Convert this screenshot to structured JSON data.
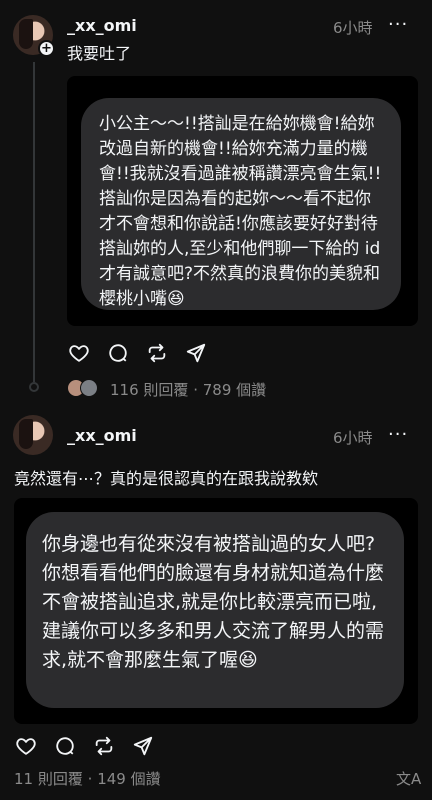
{
  "post1": {
    "username": "_xx_omi",
    "time": "6小時",
    "more_icon": "more-horizontal-icon",
    "text": "我要吐了",
    "bubble_text": "小公主～～!!搭訕是在給妳機會!給妳改過自新的機會!!給妳充滿力量的機會!!我就沒看過誰被稱讚漂亮會生氣!!搭訕你是因為看的起妳～～看不起你才不會想和你說話!你應該要好好對待搭訕妳的人,至少和他們聊一下給的 id 才有誠意吧?不然真的浪費你的美貌和櫻桃小嘴😆",
    "replies": "116 則回覆",
    "separator": "·",
    "views": "789 個讚"
  },
  "post2": {
    "username": "_xx_omi",
    "time": "6小時",
    "more_icon": "more-horizontal-icon",
    "text": "竟然還有⋯？真的是很認真的在跟我說教欸",
    "bubble_text": "你身邊也有從來沒有被搭訕過的女人吧?你想看看他們的臉還有身材就知道為什麼不會被搭訕追求,就是你比較漂亮而已啦,建議你可以多多和男人交流了解男人的需求,就不會那麼生氣了喔😆",
    "replies": "11 則回覆",
    "separator": "·",
    "views": "149 個讚",
    "translate_icon": "translate-icon"
  },
  "icons": {
    "plus": "+",
    "more": "···",
    "translate": "文A"
  },
  "colors": {
    "background": "#101010",
    "bubble": "#2c2c2e",
    "muted_text": "#8a8a8a"
  }
}
